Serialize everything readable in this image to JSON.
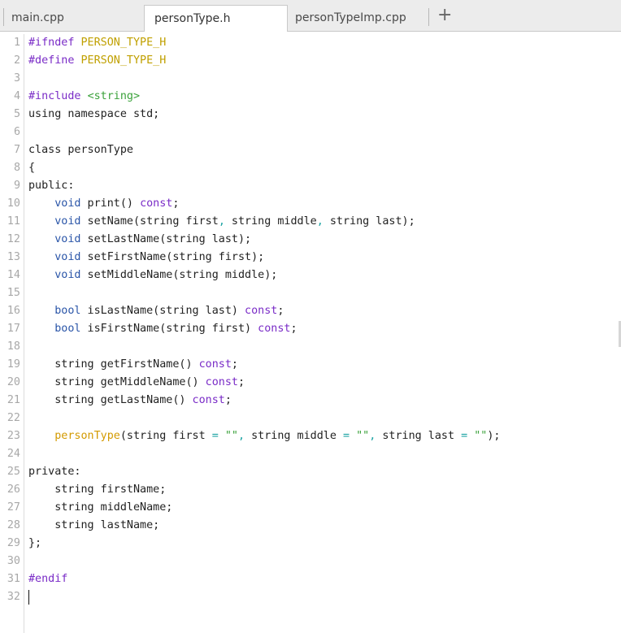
{
  "tabs": [
    {
      "label": "main.cpp",
      "active": false
    },
    {
      "label": "personType.h",
      "active": true
    },
    {
      "label": "personTypeImp.cpp",
      "active": false
    }
  ],
  "new_tab_label": "+",
  "lines": [
    {
      "n": "1",
      "tokens": [
        [
          "k",
          "#ifndef"
        ],
        [
          "",
          "",
          ""
        ],
        [
          "",
          " "
        ],
        [
          "m",
          "PERSON_TYPE_H"
        ]
      ]
    },
    {
      "n": "2",
      "tokens": [
        [
          "k",
          "#define"
        ],
        [
          "",
          " "
        ],
        [
          "m",
          "PERSON_TYPE_H"
        ]
      ]
    },
    {
      "n": "3",
      "tokens": []
    },
    {
      "n": "4",
      "tokens": [
        [
          "k",
          "#include"
        ],
        [
          "",
          " "
        ],
        [
          "s",
          "<string>"
        ]
      ]
    },
    {
      "n": "5",
      "tokens": [
        [
          "",
          "using namespace std;"
        ]
      ]
    },
    {
      "n": "6",
      "tokens": []
    },
    {
      "n": "7",
      "tokens": [
        [
          "",
          "class personType"
        ]
      ]
    },
    {
      "n": "8",
      "tokens": [
        [
          "",
          "{"
        ]
      ]
    },
    {
      "n": "9",
      "tokens": [
        [
          "",
          "public:"
        ]
      ]
    },
    {
      "n": "10",
      "tokens": [
        [
          "",
          "    "
        ],
        [
          "kb",
          "void"
        ],
        [
          "",
          " print() "
        ],
        [
          "k",
          "const"
        ],
        [
          "",
          ";"
        ]
      ]
    },
    {
      "n": "11",
      "tokens": [
        [
          "",
          "    "
        ],
        [
          "kb",
          "void"
        ],
        [
          "",
          " setName(string first"
        ],
        [
          "o",
          ","
        ],
        [
          "",
          " string middle"
        ],
        [
          "o",
          ","
        ],
        [
          "",
          " string last);"
        ]
      ]
    },
    {
      "n": "12",
      "tokens": [
        [
          "",
          "    "
        ],
        [
          "kb",
          "void"
        ],
        [
          "",
          " setLastName(string last);"
        ]
      ]
    },
    {
      "n": "13",
      "tokens": [
        [
          "",
          "    "
        ],
        [
          "kb",
          "void"
        ],
        [
          "",
          " setFirstName(string first);"
        ]
      ]
    },
    {
      "n": "14",
      "tokens": [
        [
          "",
          "    "
        ],
        [
          "kb",
          "void"
        ],
        [
          "",
          " setMiddleName(string middle);"
        ]
      ]
    },
    {
      "n": "15",
      "tokens": []
    },
    {
      "n": "16",
      "tokens": [
        [
          "",
          "    "
        ],
        [
          "kb",
          "bool"
        ],
        [
          "",
          " isLastName(string last) "
        ],
        [
          "k",
          "const"
        ],
        [
          "",
          ";"
        ]
      ]
    },
    {
      "n": "17",
      "tokens": [
        [
          "",
          "    "
        ],
        [
          "kb",
          "bool"
        ],
        [
          "",
          " isFirstName(string first) "
        ],
        [
          "k",
          "const"
        ],
        [
          "",
          ";"
        ]
      ]
    },
    {
      "n": "18",
      "tokens": []
    },
    {
      "n": "19",
      "tokens": [
        [
          "",
          "    string getFirstName() "
        ],
        [
          "k",
          "const"
        ],
        [
          "",
          ";"
        ]
      ]
    },
    {
      "n": "20",
      "tokens": [
        [
          "",
          "    string getMiddleName() "
        ],
        [
          "k",
          "const"
        ],
        [
          "",
          ";"
        ]
      ]
    },
    {
      "n": "21",
      "tokens": [
        [
          "",
          "    string getLastName() "
        ],
        [
          "k",
          "const"
        ],
        [
          "",
          ";"
        ]
      ]
    },
    {
      "n": "22",
      "tokens": []
    },
    {
      "n": "23",
      "tokens": [
        [
          "",
          "    "
        ],
        [
          "t",
          "personType"
        ],
        [
          "",
          "(string first "
        ],
        [
          "o",
          "="
        ],
        [
          "",
          " "
        ],
        [
          "s",
          "\"\""
        ],
        [
          "o",
          ","
        ],
        [
          "",
          " string middle "
        ],
        [
          "o",
          "="
        ],
        [
          "",
          " "
        ],
        [
          "s",
          "\"\""
        ],
        [
          "o",
          ","
        ],
        [
          "",
          " string last "
        ],
        [
          "o",
          "="
        ],
        [
          "",
          " "
        ],
        [
          "s",
          "\"\""
        ],
        [
          "",
          ");"
        ]
      ]
    },
    {
      "n": "24",
      "tokens": []
    },
    {
      "n": "25",
      "tokens": [
        [
          "",
          "private:"
        ]
      ]
    },
    {
      "n": "26",
      "tokens": [
        [
          "",
          "    string firstName;"
        ]
      ]
    },
    {
      "n": "27",
      "tokens": [
        [
          "",
          "    string middleName;"
        ]
      ]
    },
    {
      "n": "28",
      "tokens": [
        [
          "",
          "    string lastName;"
        ]
      ]
    },
    {
      "n": "29",
      "tokens": [
        [
          "",
          "};"
        ]
      ]
    },
    {
      "n": "30",
      "tokens": []
    },
    {
      "n": "31",
      "tokens": [
        [
          "k",
          "#endif"
        ]
      ]
    },
    {
      "n": "32",
      "tokens": []
    }
  ],
  "cursor_line": "32"
}
